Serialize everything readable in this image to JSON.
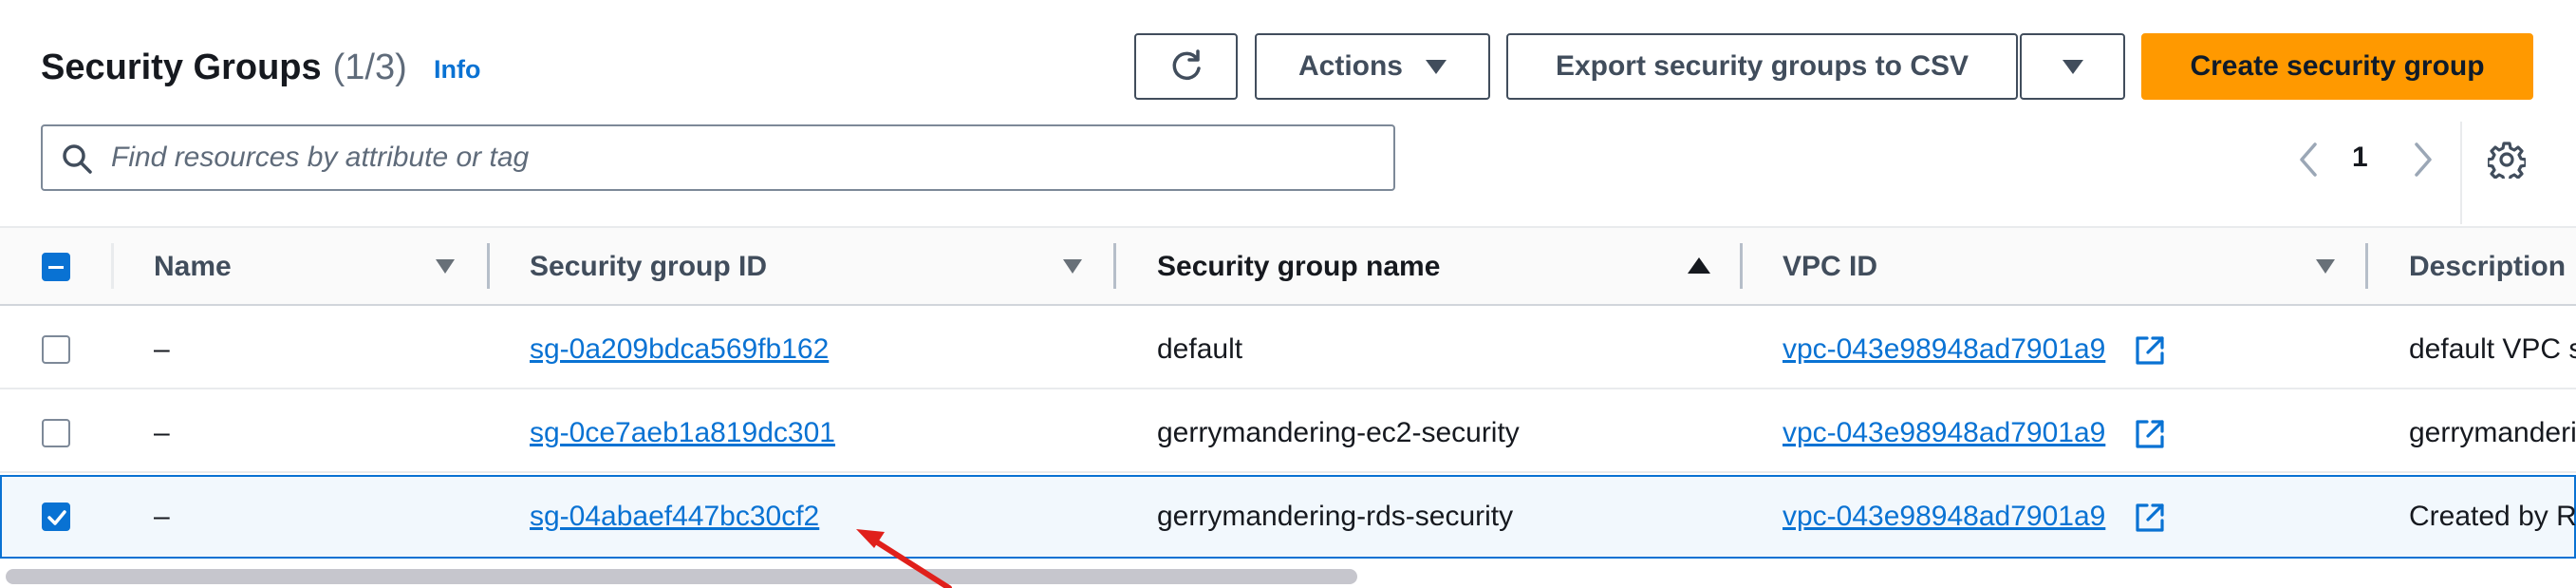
{
  "header": {
    "title": "Security Groups",
    "count": "(1/3)",
    "info": "Info"
  },
  "toolbar": {
    "actions_label": "Actions",
    "export_label": "Export security groups to CSV",
    "create_label": "Create security group"
  },
  "search": {
    "placeholder": "Find resources by attribute or tag",
    "value": ""
  },
  "pagination": {
    "current_page": "1"
  },
  "table": {
    "columns": [
      "Name",
      "Security group ID",
      "Security group name",
      "VPC ID",
      "Description"
    ],
    "rows": [
      {
        "selected": false,
        "name": "–",
        "sg_id": "sg-0a209bdca569fb162",
        "sg_name": "default",
        "vpc_id": "vpc-043e98948ad7901a9",
        "description": "default VPC s"
      },
      {
        "selected": false,
        "name": "–",
        "sg_id": "sg-0ce7aeb1a819dc301",
        "sg_name": "gerrymandering-ec2-security",
        "vpc_id": "vpc-043e98948ad7901a9",
        "description": "gerrymandering"
      },
      {
        "selected": true,
        "name": "–",
        "sg_id": "sg-04abaef447bc30cf2",
        "sg_name": "gerrymandering-rds-security",
        "vpc_id": "vpc-043e98948ad7901a9",
        "description": "Created by RD"
      }
    ]
  },
  "colors": {
    "accent": "#0972d3",
    "primary_button": "#ff9900",
    "annotation_arrow": "#e0201b"
  }
}
